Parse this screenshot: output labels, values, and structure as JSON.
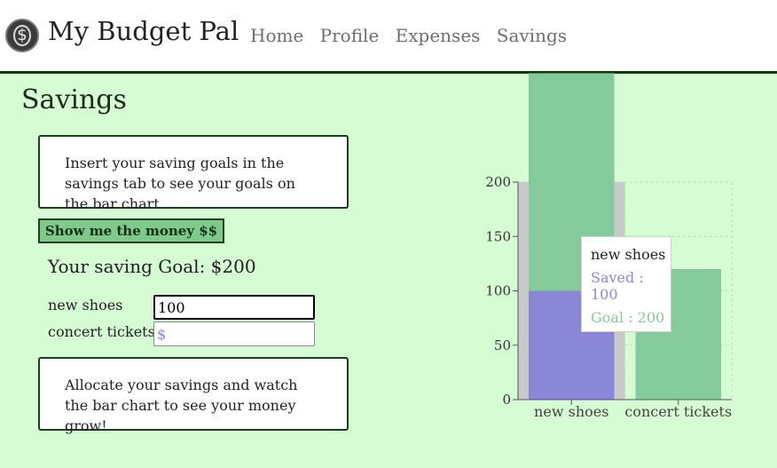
{
  "app": {
    "title": "My Budget Pal",
    "logo_symbol": "$"
  },
  "nav": {
    "items": [
      "Home",
      "Profile",
      "Expenses",
      "Savings"
    ]
  },
  "page": {
    "title": "Savings"
  },
  "intro_card": {
    "text": "Insert your saving goals in the savings tab to see your goals on the bar chart"
  },
  "action_button": {
    "label": "Show me the money $$"
  },
  "goal_text": "Your saving Goal: $200",
  "allocations": [
    {
      "label": "new shoes",
      "value": "100",
      "placeholder": "$"
    },
    {
      "label": "concert tickets",
      "value": "",
      "placeholder": "$"
    }
  ],
  "footer_card": {
    "text": "Allocate your savings and watch the bar chart to see your money grow!"
  },
  "tooltip": {
    "category": "new shoes",
    "saved_text": "Saved : 100",
    "goal_text": "Goal : 200"
  },
  "colors": {
    "saved": "#8a87d8",
    "goal": "#84ca9b",
    "highlight": "#c9c9c9"
  },
  "chart_data": {
    "type": "bar",
    "stacked": true,
    "categories": [
      "new shoes",
      "concert tickets"
    ],
    "series": [
      {
        "name": "Saved",
        "values": [
          100,
          0
        ]
      },
      {
        "name": "Goal",
        "values": [
          200,
          120
        ]
      }
    ],
    "ylim": [
      0,
      200
    ],
    "yticks": [
      0,
      50,
      100,
      150,
      200
    ],
    "grid": true,
    "hovered_category": "new shoes"
  }
}
